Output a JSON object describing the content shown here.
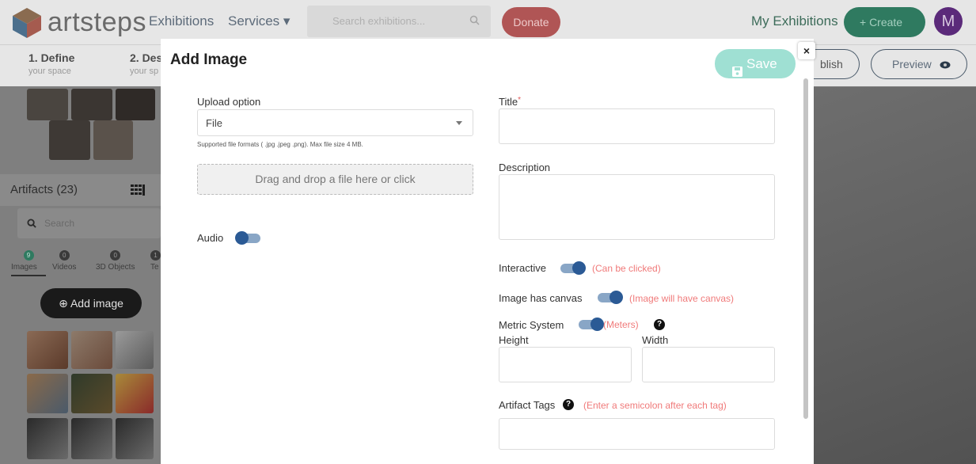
{
  "header": {
    "logo_text": "artsteps",
    "nav": {
      "exhibitions": "Exhibitions",
      "services": "Services ▾"
    },
    "search": {
      "placeholder": "Search exhibitions..."
    },
    "donate_label": "Donate",
    "my_exhibitions_label": "My Exhibitions",
    "create_label": "+ Create",
    "avatar_letter": "M"
  },
  "steps": [
    {
      "title": "1. Define",
      "subtitle": "your space"
    },
    {
      "title": "2. Des",
      "subtitle": "your sp"
    }
  ],
  "actions": {
    "publish_label": "blish",
    "preview_label": "Preview"
  },
  "sidebar": {
    "artifacts_title": "Artifacts (23)",
    "search_placeholder": "Search",
    "tabs": [
      {
        "count": "9",
        "label": "Images"
      },
      {
        "count": "0",
        "label": "Videos"
      },
      {
        "count": "0",
        "label": "3D Objects"
      },
      {
        "count": "1",
        "label": "Te"
      }
    ],
    "add_image_label": "⊕ Add image"
  },
  "modal": {
    "title": "Add Image",
    "save_label": "Save",
    "close_label": "×",
    "upload_option": {
      "label": "Upload option",
      "value": "File",
      "hint": "Supported file formats ( .jpg .jpeg .png). Max file size 4 MB."
    },
    "dropzone_text": "Drag and drop a file here or click",
    "audio_label": "Audio",
    "audio_on": false,
    "title_field": {
      "label": "Title",
      "required_mark": "*",
      "value": ""
    },
    "description_field": {
      "label": "Description",
      "value": ""
    },
    "interactive": {
      "label": "Interactive",
      "note": "(Can be clicked)",
      "on": true
    },
    "image_canvas": {
      "label": "Image has canvas",
      "note": "(Image will have canvas)",
      "on": true
    },
    "metric": {
      "label": "Metric System",
      "note": "(Meters)",
      "on": true,
      "help": "?"
    },
    "height_label": "Height",
    "width_label": "Width",
    "tags": {
      "label": "Artifact Tags",
      "note": "(Enter a semicolon after each tag)",
      "help": "?"
    }
  },
  "colors": {
    "save_bg": "#9fe0d3",
    "toggle_track": "#89a6c6",
    "toggle_knob": "#2b5a95",
    "note_text": "#f07a7a"
  }
}
